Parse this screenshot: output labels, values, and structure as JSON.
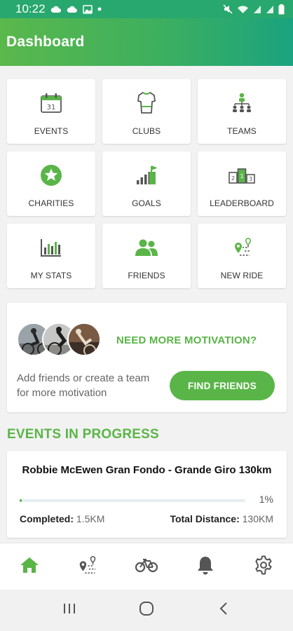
{
  "status_bar": {
    "time": "10:22",
    "left_icons": [
      "cloud-icon",
      "cloud-icon",
      "image-icon",
      "dot-icon"
    ],
    "right_icons": [
      "mute-icon",
      "wifi-icon",
      "signal-icon",
      "signal-icon",
      "battery-icon"
    ]
  },
  "app_bar": {
    "title": "Dashboard"
  },
  "tiles": [
    {
      "label": "EVENTS",
      "icon": "calendar-icon"
    },
    {
      "label": "CLUBS",
      "icon": "jersey-icon"
    },
    {
      "label": "TEAMS",
      "icon": "team-hierarchy-icon"
    },
    {
      "label": "CHARITIES",
      "icon": "star-badge-icon"
    },
    {
      "label": "GOALS",
      "icon": "goal-bars-flag-icon"
    },
    {
      "label": "LEADERBOARD",
      "icon": "podium-icon"
    },
    {
      "label": "MY STATS",
      "icon": "bar-chart-icon"
    },
    {
      "label": "FRIENDS",
      "icon": "people-icon"
    },
    {
      "label": "NEW RIDE",
      "icon": "route-pin-icon"
    }
  ],
  "motivation": {
    "heading": "NEED MORE MOTIVATION?",
    "text": "Add friends or create a team for more motivation",
    "button_label": "FIND FRIENDS"
  },
  "events_section": {
    "title": "EVENTS IN PROGRESS",
    "event": {
      "name": "Robbie McEwen Gran Fondo - Grande Giro 130km",
      "progress_percent": 1,
      "progress_label": "1%",
      "completed_label": "Completed:",
      "completed_value": "1.5KM",
      "total_label": "Total Distance:",
      "total_value": "130KM"
    }
  },
  "bottom_nav": {
    "items": [
      "home-icon",
      "route-icon",
      "bike-icon",
      "bell-icon",
      "settings-icon"
    ],
    "active": "home-icon"
  },
  "system_nav": [
    "recent-apps-icon",
    "home-circle-icon",
    "back-icon"
  ],
  "colors": {
    "brand_green": "#5ab548",
    "header_gradient_start": "#5ab84c",
    "header_gradient_end": "#1aa37f",
    "icon_gray": "#555555"
  }
}
